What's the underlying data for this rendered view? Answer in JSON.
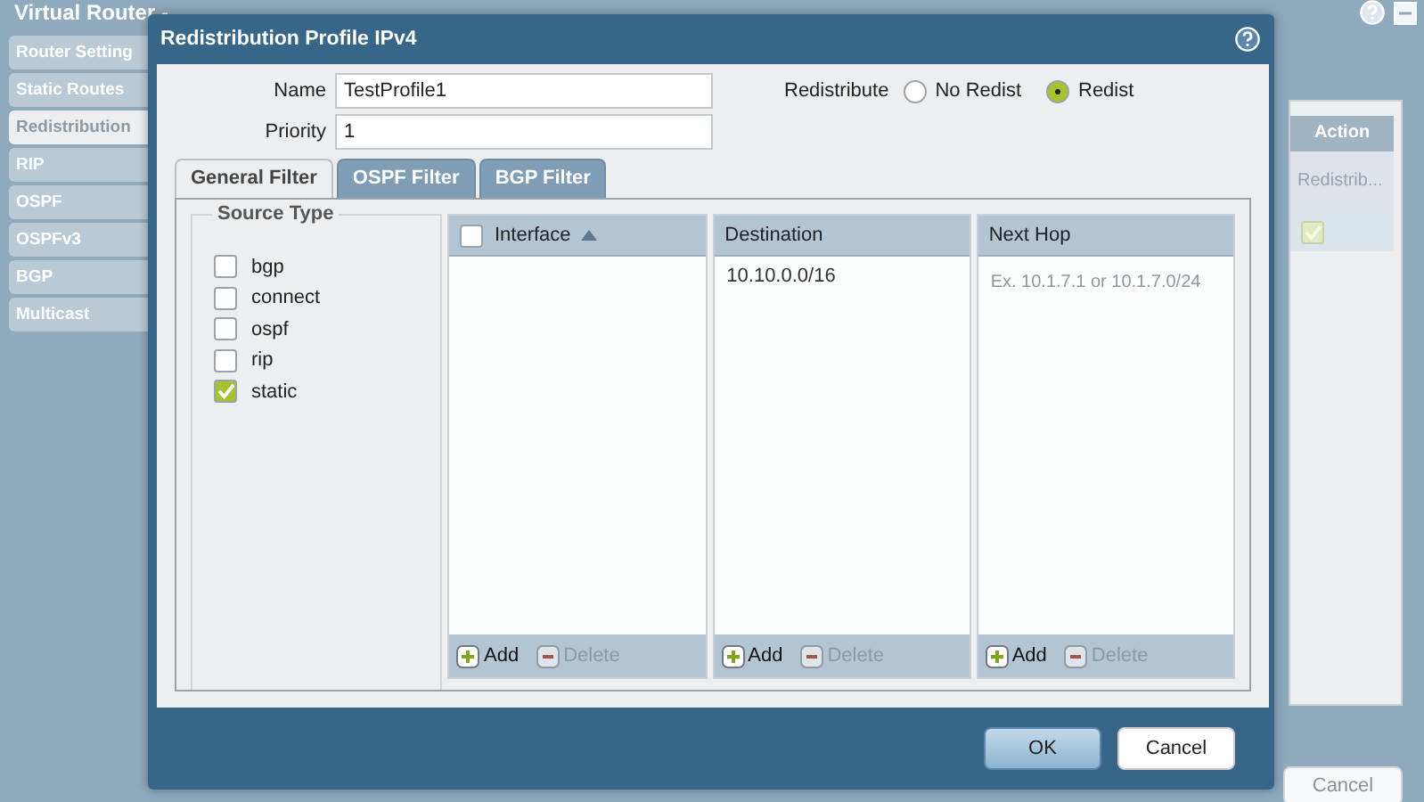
{
  "background_window": {
    "title": "Virtual Router -",
    "tabs": [
      {
        "label": "Router Setting",
        "selected": false
      },
      {
        "label": "Static Routes",
        "selected": false
      },
      {
        "label": "Redistribution",
        "selected": true
      },
      {
        "label": "RIP",
        "selected": false
      },
      {
        "label": "OSPF",
        "selected": false
      },
      {
        "label": "OSPFv3",
        "selected": false
      },
      {
        "label": "BGP",
        "selected": false
      },
      {
        "label": "Multicast",
        "selected": false
      }
    ],
    "table": {
      "header": "Action",
      "subheader": "Redistrib...",
      "rows": [
        {
          "checked": true
        }
      ]
    },
    "button": "Cancel"
  },
  "dialog": {
    "title": "Redistribution Profile IPv4",
    "fields": [
      {
        "label": "Name",
        "value": "TestProfile1"
      },
      {
        "label": "Priority",
        "value": "1"
      }
    ],
    "redistribute": {
      "label": "Redistribute",
      "options": [
        {
          "label": "No Redist",
          "selected": false
        },
        {
          "label": "Redist",
          "selected": true
        }
      ]
    },
    "tabs": [
      {
        "label": "General Filter",
        "selected": true
      },
      {
        "label": "OSPF Filter",
        "selected": false
      },
      {
        "label": "BGP Filter",
        "selected": false
      }
    ],
    "source_type": {
      "title": "Source Type",
      "options": [
        {
          "label": "bgp",
          "checked": false
        },
        {
          "label": "connect",
          "checked": false
        },
        {
          "label": "ospf",
          "checked": false
        },
        {
          "label": "rip",
          "checked": false
        },
        {
          "label": "static",
          "checked": true
        }
      ]
    },
    "grids": [
      {
        "kind": "selectable",
        "header": "Interface",
        "select_all_checked": false,
        "actions": [
          {
            "label": "Add",
            "disabled": false
          },
          {
            "label": "Delete",
            "disabled": true
          }
        ]
      },
      {
        "kind": "plain",
        "header": "Destination",
        "rows": [
          "10.10.0.0/16"
        ],
        "actions": [
          {
            "label": "Add",
            "disabled": false
          },
          {
            "label": "Delete",
            "disabled": true
          }
        ]
      },
      {
        "kind": "plain",
        "header": "Next Hop",
        "placeholder": "Ex. 10.1.7.1 or 10.1.7.0/24",
        "actions": [
          {
            "label": "Add",
            "disabled": false
          },
          {
            "label": "Delete",
            "disabled": true
          }
        ]
      }
    ],
    "buttons": [
      {
        "label": "OK",
        "kind": "primary"
      },
      {
        "label": "Cancel",
        "kind": "secondary"
      }
    ]
  }
}
